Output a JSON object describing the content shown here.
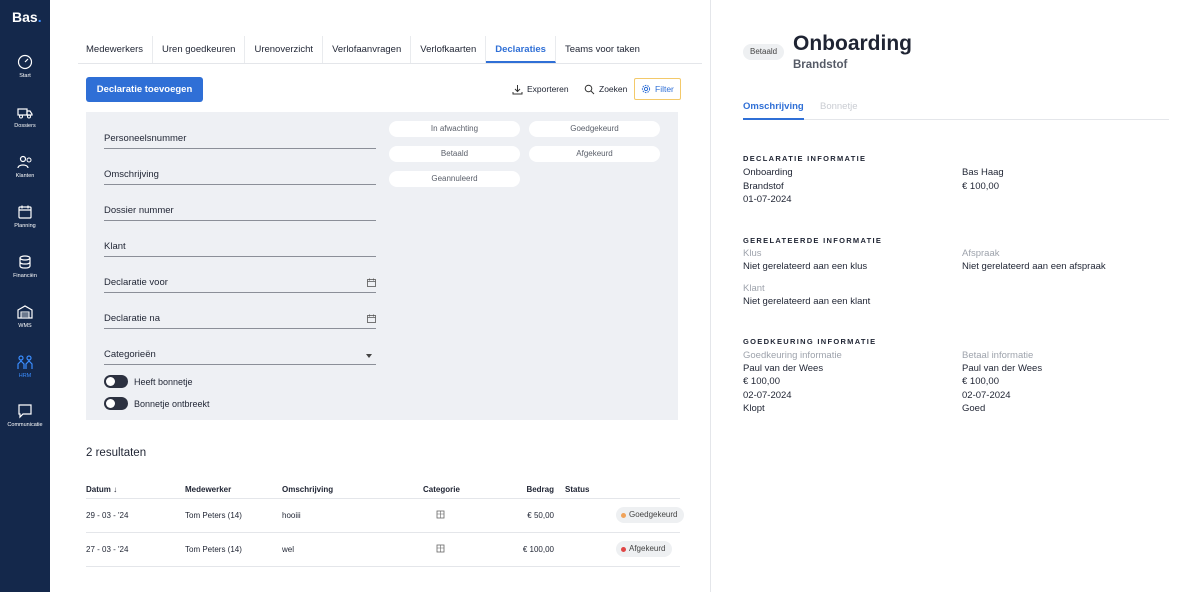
{
  "app": {
    "logo": "Bas",
    "logo_dot": "."
  },
  "sidebar": {
    "items": [
      {
        "label": "Start",
        "icon": "gauge-icon",
        "active": false
      },
      {
        "label": "Dossiers",
        "icon": "truck-icon",
        "active": false
      },
      {
        "label": "Klanten",
        "icon": "users-icon",
        "active": false
      },
      {
        "label": "Planning",
        "icon": "calendar-icon",
        "active": false
      },
      {
        "label": "Financiën",
        "icon": "coins-icon",
        "active": false
      },
      {
        "label": "WMS",
        "icon": "warehouse-icon",
        "active": false
      },
      {
        "label": "HRM",
        "icon": "people-icon",
        "active": true
      },
      {
        "label": "Communicatie",
        "icon": "chat-icon",
        "active": false
      }
    ]
  },
  "tabs": [
    "Medewerkers",
    "Uren goedkeuren",
    "Urenoverzicht",
    "Verlofaanvragen",
    "Verlofkaarten",
    "Declaraties",
    "Teams voor taken"
  ],
  "active_tab": "Declaraties",
  "toolbar": {
    "add_label": "Declaratie toevoegen",
    "export_label": "Exporteren",
    "search_label": "Zoeken",
    "filter_label": "Filter"
  },
  "filters": {
    "fields": [
      "Personeelsnummer",
      "Omschrijving",
      "Dossier nummer",
      "Klant",
      "Declaratie voor",
      "Declaratie na",
      "Categorieën"
    ],
    "status_chips": [
      "In afwachting",
      "Goedgekeurd",
      "Betaald",
      "Afgekeurd",
      "Geannuleerd"
    ],
    "toggles": [
      "Heeft bonnetje",
      "Bonnetje ontbreekt"
    ]
  },
  "results_label": "2 resultaten",
  "table": {
    "headers": {
      "date": "Datum",
      "sort_arrow": "↓",
      "employee": "Medewerker",
      "description": "Omschrijving",
      "category": "Categorie",
      "amount": "Bedrag",
      "status": "Status"
    },
    "rows": [
      {
        "date": "29 - 03 - '24",
        "employee": "Tom Peters (14)",
        "description": "hooiii",
        "amount": "€ 50,00",
        "status": "Goedgekeurd",
        "status_color": "#f0a35a"
      },
      {
        "date": "27 - 03 - '24",
        "employee": "Tom Peters (14)",
        "description": "wel",
        "amount": "€ 100,00",
        "status": "Afgekeurd",
        "status_color": "#e04646"
      }
    ]
  },
  "detail": {
    "badge": "Betaald",
    "title": "Onboarding",
    "subtitle": "Brandstof",
    "tabs": [
      "Omschrijving",
      "Bonnetje"
    ],
    "declaratie": {
      "heading": "DECLARATIE INFORMATIE",
      "description": "Onboarding",
      "category": "Brandstof",
      "date": "01-07-2024",
      "employee": "Bas Haag",
      "amount": "€ 100,00"
    },
    "related": {
      "heading": "GERELATEERDE INFORMATIE",
      "klus_label": "Klus",
      "klus_value": "Niet gerelateerd aan een klus",
      "afspraak_label": "Afspraak",
      "afspraak_value": "Niet gerelateerd aan een afspraak",
      "klant_label": "Klant",
      "klant_value": "Niet gerelateerd aan een klant"
    },
    "approval": {
      "heading": "GOEDKEURING INFORMATIE",
      "left_label": "Goedkeuring informatie",
      "left_name": "Paul van der Wees",
      "left_amount": "€ 100,00",
      "left_date": "02-07-2024",
      "left_note": "Klopt",
      "right_label": "Betaal informatie",
      "right_name": "Paul van der Wees",
      "right_amount": "€ 100,00",
      "right_date": "02-07-2024",
      "right_note": "Goed"
    }
  },
  "colors": {
    "sidebar": "#14284b",
    "accent": "#2f6fd6",
    "panel": "#eef0f4"
  }
}
